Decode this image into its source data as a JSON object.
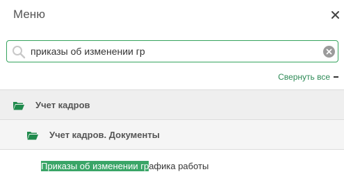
{
  "header": {
    "title": "Меню",
    "close_icon": "close-icon"
  },
  "search": {
    "value": "приказы об изменении гр",
    "icon": "search-icon",
    "clear_icon": "clear-icon"
  },
  "collapse": {
    "label": "Свернуть все",
    "icon": "minus-icon"
  },
  "tree": {
    "folder_1": {
      "label": "Учет кадров",
      "icon": "folder-open-icon"
    },
    "folder_2": {
      "label": "Учет кадров. Документы",
      "icon": "folder-open-icon"
    },
    "item": {
      "match": "Приказы об изменении гр",
      "rest": "афика работы"
    }
  },
  "colors": {
    "accent": "#35a35d",
    "highlight": "#3aa567",
    "folder": "#1f8a4c"
  }
}
